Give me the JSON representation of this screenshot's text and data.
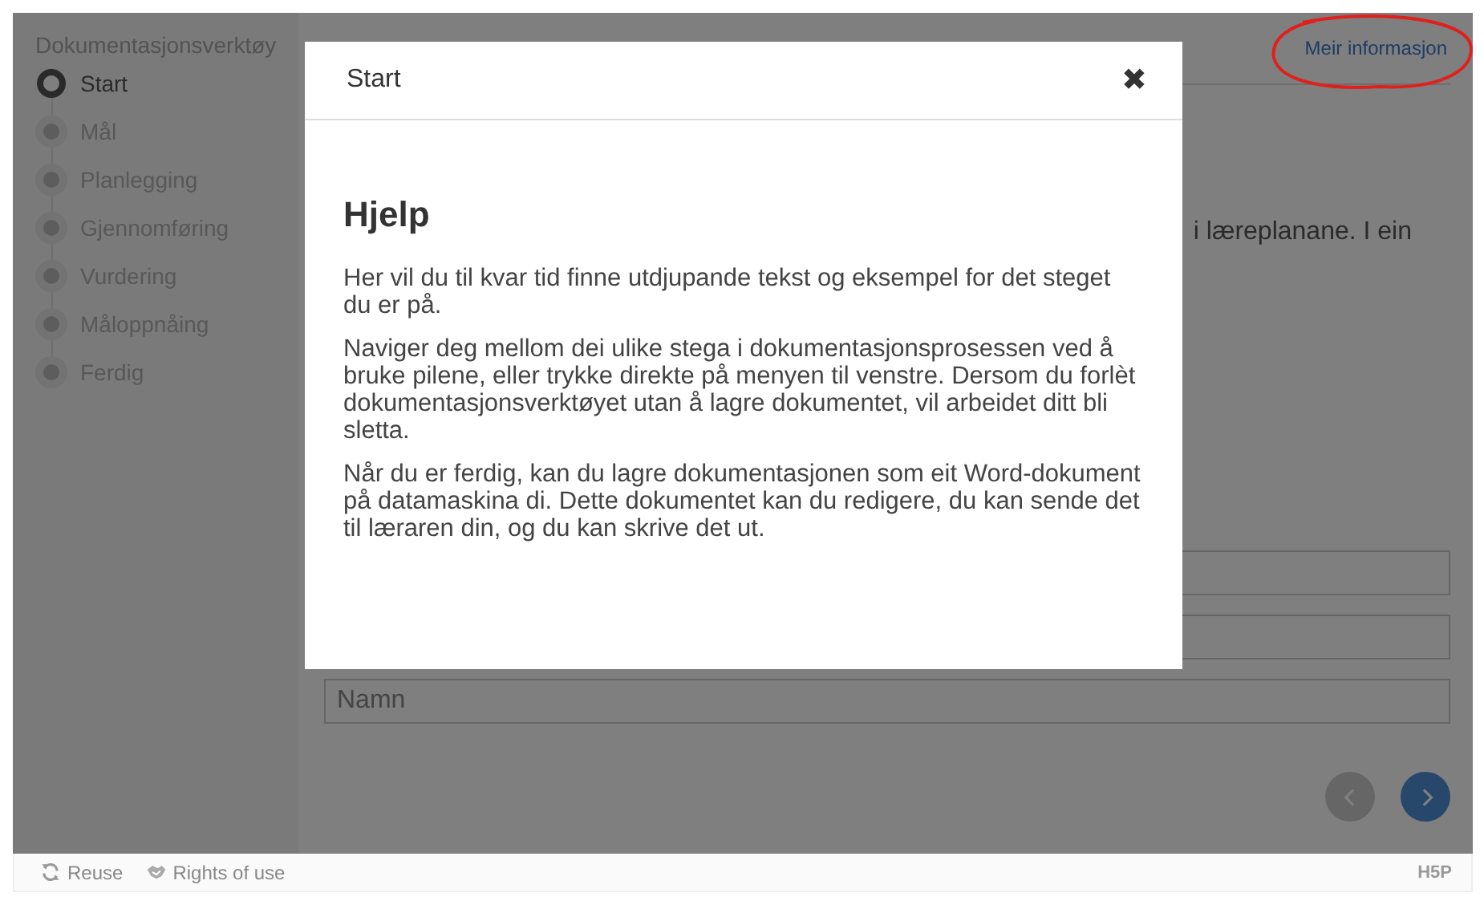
{
  "sidebar": {
    "title": "Dokumentasjonsverktøy",
    "steps": [
      {
        "label": "Start",
        "selected": true
      },
      {
        "label": "Mål",
        "selected": false
      },
      {
        "label": "Planlegging",
        "selected": false
      },
      {
        "label": "Gjennomføring",
        "selected": false
      },
      {
        "label": "Vurdering",
        "selected": false
      },
      {
        "label": "Måloppnåing",
        "selected": false
      },
      {
        "label": "Ferdig",
        "selected": false
      }
    ]
  },
  "header": {
    "link": "Meir informasjon"
  },
  "content": {
    "text": "i læreplanane. I ein",
    "fields": [
      {
        "kind": "input"
      },
      {
        "kind": "input"
      },
      {
        "kind": "input",
        "placeholder": "Namn"
      }
    ]
  },
  "navigation": {
    "previous": {
      "disabled": true
    },
    "next": {
      "disabled": false
    }
  },
  "dialog": {
    "title": "Start",
    "close": "✖",
    "heading": "Hjelp",
    "paragraphs": [
      "Her vil du til kvar tid finne utdjupande tekst og eksempel for det steget du er på.",
      "Naviger deg mellom dei ulike stega i dokumentasjonsprosessen ved å bruke pilene, eller trykke direkte på menyen til venstre. Dersom du forlèt dokumentasjonsverktøyet utan å lagre dokumentet, vil arbeidet ditt bli sletta.",
      "Når du er ferdig, kan du lagre dokumentasjonen som eit Word-dokument på datamaskina di. Dette dokumentet kan du redigere, du kan sende det til læraren din, og du kan skrive det ut."
    ]
  },
  "footer": {
    "actions": [
      {
        "label": "Reuse",
        "kind": "reuse"
      },
      {
        "label": "Rights of use",
        "kind": "rights"
      }
    ],
    "logo": "H5P"
  }
}
